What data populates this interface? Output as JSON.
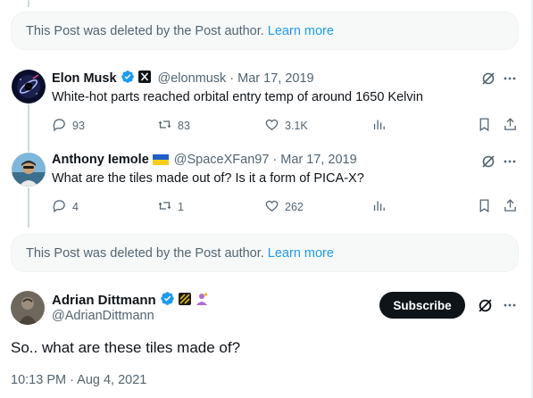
{
  "deleted_notice": {
    "text": "This Post was deleted by the Post author.",
    "link": "Learn more"
  },
  "replies": [
    {
      "name": "Elon Musk",
      "handle": "@elonmusk",
      "date": "· Mar 17, 2019",
      "text": "White-hot parts reached orbital entry temp of around 1650 Kelvin",
      "replies": "93",
      "reposts": "83",
      "likes": "3.1K"
    },
    {
      "name": "Anthony Iemole",
      "handle": "@SpaceXFan97",
      "date": "· Mar 17, 2019",
      "text": "What are the tiles made out of? Is it a form of PICA-X?",
      "replies": "4",
      "reposts": "1",
      "likes": "262"
    }
  ],
  "main_post": {
    "name": "Adrian Dittmann",
    "handle": "@AdrianDittmann",
    "subscribe_label": "Subscribe",
    "text": "So.. what are these tiles made of?",
    "timestamp": "10:13 PM · Aug 4, 2021"
  },
  "colors": {
    "accent": "#1d9bf0",
    "muted": "#536471",
    "text": "#0f1419",
    "gold_badge": "#e2b719"
  },
  "icons": [
    "grok-icon",
    "more-icon",
    "reply-icon",
    "repost-icon",
    "like-icon",
    "views-icon",
    "bookmark-icon",
    "share-icon",
    "verified-badge-icon",
    "x-affiliate-icon"
  ]
}
